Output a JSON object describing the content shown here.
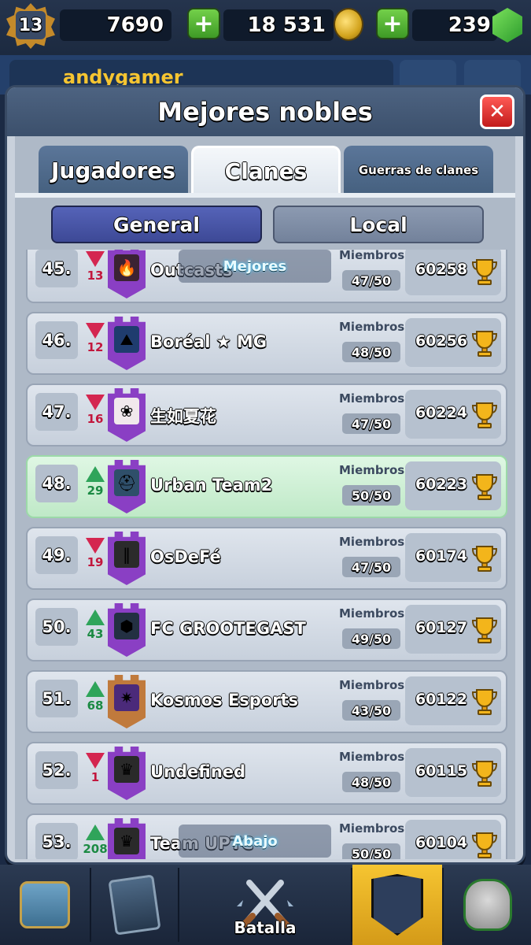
{
  "topbar": {
    "level": "13",
    "trophies": "7690",
    "gold": "18 531",
    "gems": "239"
  },
  "behind": {
    "player_name": "andygamer"
  },
  "modal": {
    "title": "Mejores nobles",
    "close": "✕",
    "tabs": [
      "Jugadores",
      "Clanes",
      "Guerras de clanes"
    ],
    "subtabs": [
      "General",
      "Local"
    ],
    "members_label": "Miembros",
    "top_overlay": "Mejores",
    "bottom_overlay": "Abajo"
  },
  "clans": [
    {
      "rank": "45.",
      "trend": "down",
      "change": "13",
      "name": "Outcasts",
      "members": "47/50",
      "trophies": "60258",
      "badge_color": "#8a3fc4",
      "emblem_color": "#3b2333",
      "emblem_glyph": "🔥",
      "highlight": false
    },
    {
      "rank": "46.",
      "trend": "down",
      "change": "12",
      "name": "Boréal ★ MG",
      "members": "48/50",
      "trophies": "60256",
      "badge_color": "#8a3fc4",
      "emblem_color": "#1f3c6e",
      "emblem_glyph": "⛰",
      "highlight": false
    },
    {
      "rank": "47.",
      "trend": "down",
      "change": "16",
      "name": "生如夏花",
      "members": "47/50",
      "trophies": "60224",
      "badge_color": "#8a3fc4",
      "emblem_color": "#f1e8ec",
      "emblem_glyph": "❀",
      "highlight": false
    },
    {
      "rank": "48.",
      "trend": "up",
      "change": "29",
      "name": "Urban Team2",
      "members": "50/50",
      "trophies": "60223",
      "badge_color": "#8a3fc4",
      "emblem_color": "#2f4f6a",
      "emblem_glyph": "⛑",
      "highlight": true
    },
    {
      "rank": "49.",
      "trend": "down",
      "change": "19",
      "name": "OsDeFé",
      "members": "47/50",
      "trophies": "60174",
      "badge_color": "#8a3fc4",
      "emblem_color": "#2b2b2b",
      "emblem_glyph": "‖",
      "highlight": false
    },
    {
      "rank": "50.",
      "trend": "up",
      "change": "43",
      "name": "FC GROOTEGAST",
      "members": "49/50",
      "trophies": "60127",
      "badge_color": "#8a3fc4",
      "emblem_color": "#233042",
      "emblem_glyph": "⬢",
      "highlight": false
    },
    {
      "rank": "51.",
      "trend": "up",
      "change": "68",
      "name": "Kosmos Esports",
      "members": "43/50",
      "trophies": "60122",
      "badge_color": "#c07a3c",
      "emblem_color": "#4b2a7a",
      "emblem_glyph": "✷",
      "highlight": false
    },
    {
      "rank": "52.",
      "trend": "down",
      "change": "1",
      "name": "Undefined",
      "members": "48/50",
      "trophies": "60115",
      "badge_color": "#8a3fc4",
      "emblem_color": "#2a2a2a",
      "emblem_glyph": "♛",
      "highlight": false
    },
    {
      "rank": "53.",
      "trend": "up",
      "change": "208",
      "name": "Team UPTC",
      "members": "50/50",
      "trophies": "60104",
      "badge_color": "#8a3fc4",
      "emblem_color": "#2a2a2a",
      "emblem_glyph": "♛",
      "highlight": false
    }
  ],
  "bottomnav": {
    "battle_label": "Batalla"
  }
}
